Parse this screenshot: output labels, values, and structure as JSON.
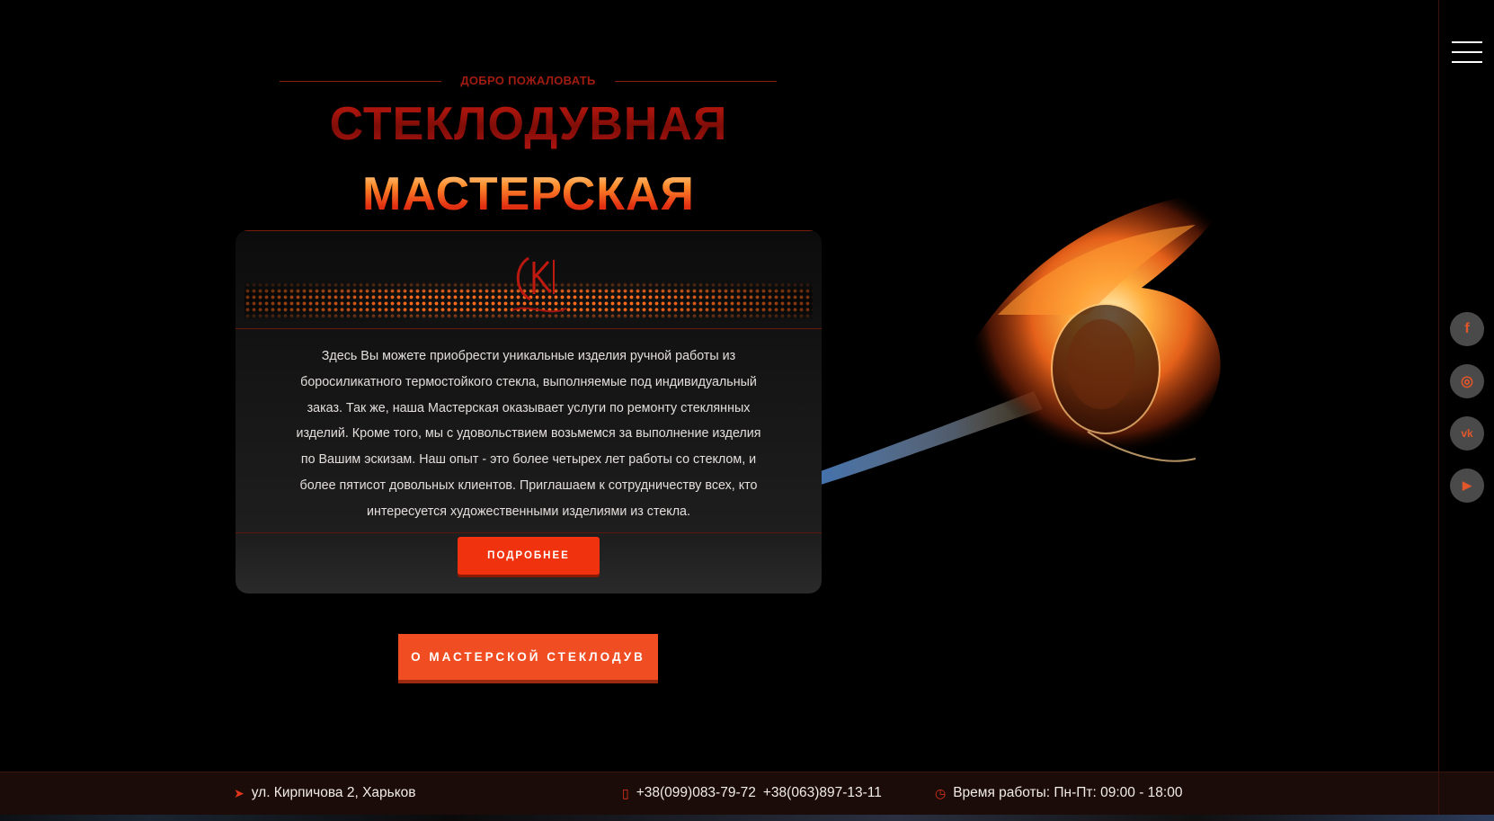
{
  "hero": {
    "welcome": "ДОБРО ПОЖАЛОВАТЬ",
    "title_line1": "СТЕКЛОДУВНАЯ",
    "title_line2": "МАСТЕРСКАЯ"
  },
  "card": {
    "text": "Здесь Вы можете приобрести уникальные изделия ручной работы из боросиликатного термостойкого стекла, выполняемые под индивидуальный заказ. Так же, наша Мастерская оказывает услуги по ремонту стеклянных изделий. Кроме того, мы с удовольствием возьмемся за выполнение изделия по Вашим эскизам. Наш опыт - это более четырех лет работы со стеклом, и более пятисот довольных клиентов. Приглашаем к сотрудничеству всех, кто интересуется художественными изделиями из стекла.",
    "more_button": "ПОДРОБНЕЕ"
  },
  "about_button": "О МАСТЕРСКОЙ СТЕКЛОДУВ",
  "rail": {
    "menu_icon": "hamburger-icon",
    "socials": [
      {
        "name": "facebook-icon",
        "glyph": "f"
      },
      {
        "name": "instagram-icon",
        "glyph": "◎"
      },
      {
        "name": "vk-icon",
        "glyph": "vk"
      },
      {
        "name": "youtube-icon",
        "glyph": "▶"
      }
    ]
  },
  "footer": {
    "address": "ул. Кирпичова 2, Харьков",
    "phone1": "+38(099)083-79-72",
    "phone2": "+38(063)897-13-11",
    "hours": "Время работы: Пн-Пт: 09:00 - 18:00"
  },
  "colors": {
    "accent": "#f04d22",
    "accent_dark": "#f0320e",
    "background": "#000000",
    "footer_bg": "#1b0c09"
  }
}
